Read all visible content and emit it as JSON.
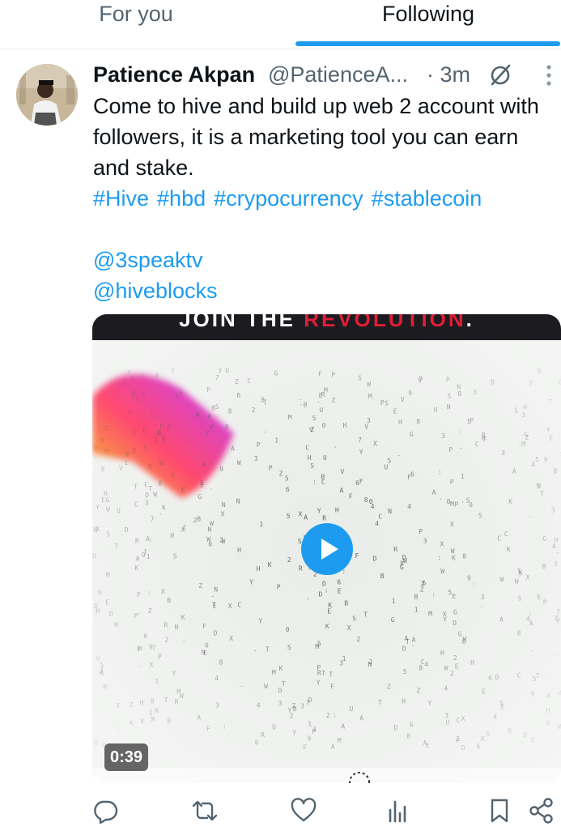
{
  "tabs": {
    "for_you": "For you",
    "following": "Following",
    "active": "following"
  },
  "post": {
    "author_name": "Patience Akpan",
    "author_handle": "@PatienceA...",
    "time": "· 3m",
    "text": "Come to hive and build up web 2 account with followers, it is a marketing tool you can earn and stake.",
    "hashtags": [
      "#Hive",
      "#hbd",
      "#crypocurrency",
      "#stablecoin"
    ],
    "mentions": [
      "@3speaktv",
      "@hiveblocks"
    ],
    "media": {
      "banner_text": "JOIN THE ",
      "banner_accent": "REVOLUTION",
      "banner_end": ".",
      "duration": "0:39"
    }
  },
  "actions": {
    "icons": [
      "reply-icon",
      "repost-icon",
      "like-icon",
      "views-icon",
      "bookmark-icon",
      "share-icon"
    ]
  },
  "colors": {
    "accent": "#1d9bf0",
    "text": "#0f1419",
    "muted": "#536471",
    "banner_red": "#e11d37"
  }
}
